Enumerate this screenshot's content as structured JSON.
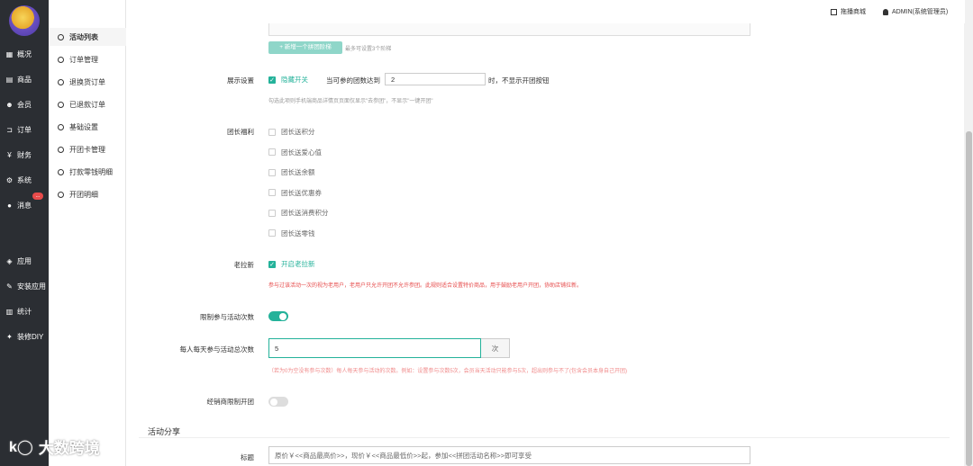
{
  "sidebar": {
    "items": [
      {
        "icon": "overview-icon",
        "label": "概况"
      },
      {
        "icon": "goods-icon",
        "label": "商品"
      },
      {
        "icon": "member-icon",
        "label": "会员"
      },
      {
        "icon": "cart-icon",
        "label": "订单"
      },
      {
        "icon": "yen-icon",
        "label": "财务"
      },
      {
        "icon": "gears-icon",
        "label": "系统"
      },
      {
        "icon": "chat-icon",
        "label": "消息"
      },
      {
        "icon": "cubes-icon",
        "label": "应用"
      },
      {
        "icon": "install-icon",
        "label": "安装应用"
      },
      {
        "icon": "chart-icon",
        "label": "统计"
      },
      {
        "icon": "brush-icon",
        "label": "装修DIY"
      }
    ],
    "message_badge": "..."
  },
  "subnav": {
    "items": [
      "活动列表",
      "订单管理",
      "退换货订单",
      "已退款订单",
      "基础设置",
      "开团卡管理",
      "打款零钱明细",
      "开团明细"
    ]
  },
  "topbar": {
    "mall_link": "拖播商城",
    "user": "ADMIN(系统管理员)"
  },
  "form": {
    "add_tier_button": "+ 新增一个拼团阶梯",
    "add_tier_hint": "最多可设置3个阶梯",
    "display_label": "展示设置",
    "hide_switch_label": "隐藏开关",
    "threshold_prefix": "当可参的团数达到",
    "threshold_value": "2",
    "threshold_suffix": "时，不显示开团按钮",
    "display_hint": "勾选此项则手机端商品详情页页面仅显示\"去参团\"，不显示\"一键开团\"",
    "leader_label": "团长福利",
    "leader_options": [
      "团长送积分",
      "团长送爱心值",
      "团长送余额",
      "团长送优惠券",
      "团长送消费积分",
      "团长送零钱"
    ],
    "old_pull_label": "老拉新",
    "old_pull_option": "开启老拉新",
    "old_pull_warn": "参与过该活动一次的视为老用户，老用户只允许开团不允许参团。此规则适合设置特价商品，用于鼓励老用户开团，协助店铺拉新。",
    "limit_label": "限制参与活动次数",
    "daily_label": "每人每天参与活动总次数",
    "daily_value": "5",
    "daily_unit": "次",
    "daily_warn": "（若为0为空没有参与次数）每人每天参与活动的次数。例如：设置参与次数5次，会员当天活动只能参与5次，超出则参与不了(包含会员本身自己开团)",
    "distributor_label": "经销商限制开团",
    "share_section": "活动分享",
    "title_label": "标题",
    "title_value": "原价￥<<商品最高价>>，现价￥<<商品最低价>>起，参加<<拼团活动名称>>即可享受"
  },
  "watermark": "大数跨境",
  "colors": {
    "accent": "#24b29a",
    "sidebar": "#2b2e33",
    "warn": "#e64a4a"
  }
}
